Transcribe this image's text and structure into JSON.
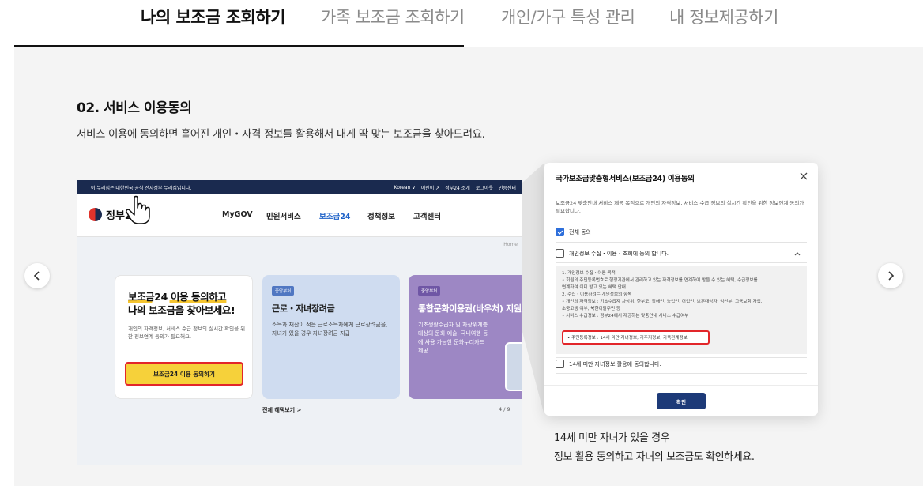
{
  "tabs": [
    {
      "label": "나의 보조금 조회하기",
      "active": true
    },
    {
      "label": "가족 보조금 조회하기",
      "active": false
    },
    {
      "label": "개인/가구 특성 관리",
      "active": false
    },
    {
      "label": "내 정보제공하기",
      "active": false
    }
  ],
  "section": {
    "title": "02. 서비스 이용동의",
    "description": "서비스 이용에 동의하면 흩어진 개인・자격 정보를 활용해서 내게 딱 맞는 보조금을 찾아드려요.",
    "caption_line1": "14세 미만 자녀가 있을 경우",
    "caption_line2": "정보 활용 동의하고 자녀의 보조금도 확인하세요."
  },
  "screenshot": {
    "gov_bar": {
      "notice": "이 누리집은 대한민국 공식 전자정부 누리집입니다.",
      "language": "Korean ∨",
      "links": [
        "어린이 ↗",
        "정부24 소개",
        "로그아웃",
        "인증센터"
      ]
    },
    "logo_text": "정부24",
    "gnb": [
      "MyGOV",
      "민원서비스",
      "보조금24",
      "정책정보",
      "고객센터"
    ],
    "breadcrumb": "Home",
    "consent_card": {
      "title_line1": "보조금24 이용 동의하고",
      "title_line2": "나의 보조금을 찾아보세요!",
      "desc": "개인의 자격정보, 서비스 수급 정보의 실시간 확인을 위한 정보연계 동의가 필요해요.",
      "button": "보조금24 이용 동의하기"
    },
    "card_blue": {
      "badge": "중앙부처",
      "title": "근로・자녀장려금",
      "desc": "소득과 재산이 적은 근로소득자에게 근로장려금을, 자녀가 있을 경우 자녀장려금 지급"
    },
    "card_purple": {
      "badge": "중앙부처",
      "title": "통합문화이용권(바우처) 지원",
      "desc": "기초생활수급자 및 차상위계층 대상의 문화 예술, 국내여행 등에 사용 가능한 문화누리카드 제공"
    },
    "more_link": "전체 혜택보기 >",
    "pager": "4 / 9"
  },
  "modal": {
    "title": "국가보조금맞춤형서비스(보조금24) 이용동의",
    "intro": "보조금24 맞춤안내 서비스 제공 목적으로 개인의 자격정보, 서비스 수급 정보의 실시간 확인을 위한 정보연계 동의가 필요합니다.",
    "agree_all": "전체 동의",
    "agree_collect": "개인정보 수집・이용・조회에 동의 합니다.",
    "detail_lines": [
      "1. 개인정보 수집・이용 목적",
      "  • 회원의 주민등록번호로 행정기관에서 관리하고 있는 자격정보를 연계하여 받을 수 있는 혜택, 수급정보를",
      "    연계하여 이미 받고 있는 혜택 안내",
      "2. 수집・이용하려는 개인정보의 항목",
      "  • 개인의 자격정보 : 기초수급자 차상위, 한부모, 장애인, 농업인, 어업인, 보훈대상자, 임산부, 고용보험 가입,",
      "    초중고생 여부, 북한이탈주민 등",
      "  • 서비스 수급정보 : 정부24에서 제공하는 맞춤안내 서비스 수급여부"
    ],
    "highlight": "• 주민등록정보 : 14세 미만 자녀정보, 거주지정보, 가족관계정보",
    "agree_child": "14세 미만 자녀정보 활용에 동의합니다.",
    "confirm": "확인"
  },
  "icons": {
    "prev": "chevron-left-icon",
    "next": "chevron-right-icon",
    "close": "close-icon",
    "caret": "chevron-up-icon",
    "hand": "pointer-hand-icon"
  },
  "colors": {
    "stage_bg": "#f4f4f4",
    "cta_yellow": "#f6d13a",
    "highlight_red": "#e2262a",
    "gnb_active": "#1e62c8",
    "confirm_navy": "#1d3a78",
    "checkbox_blue": "#2e6fdb"
  }
}
